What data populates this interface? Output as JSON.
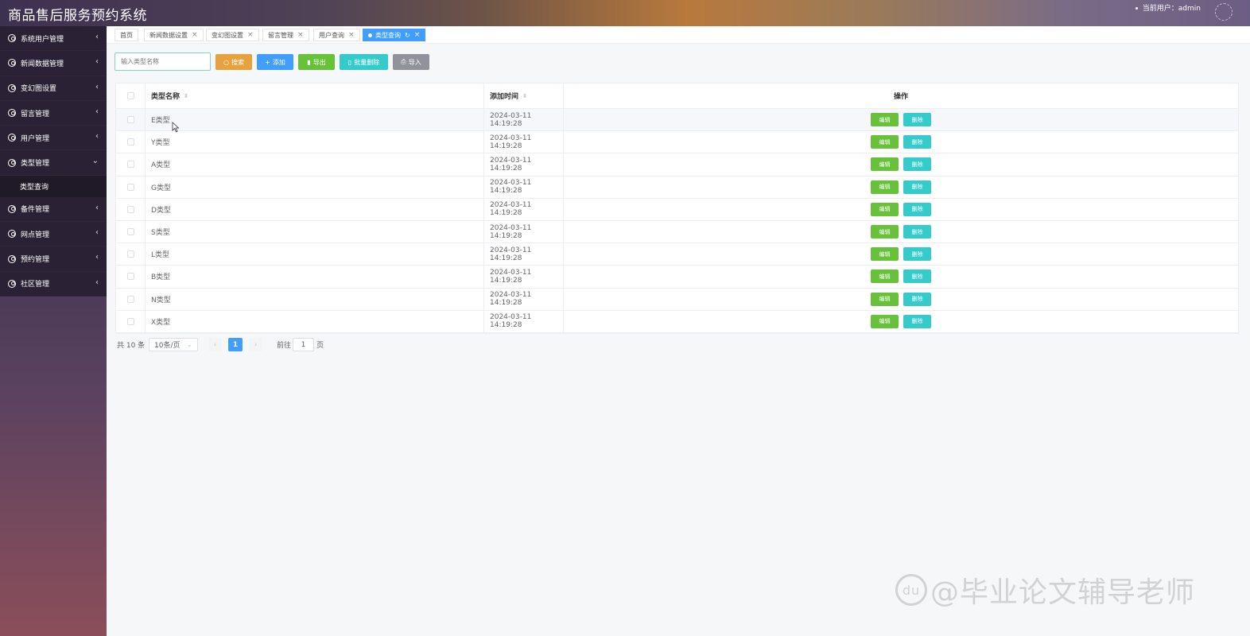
{
  "header": {
    "title": "商品售后服务预约系统",
    "user_label": "当前用户：admin"
  },
  "sidebar": {
    "items": [
      {
        "label": "系统用户管理"
      },
      {
        "label": "新闻数据管理"
      },
      {
        "label": "变幻图设置"
      },
      {
        "label": "留言管理"
      },
      {
        "label": "用户管理"
      },
      {
        "label": "类型管理"
      },
      {
        "label": "备件管理"
      },
      {
        "label": "网点管理"
      },
      {
        "label": "预约管理"
      },
      {
        "label": "社区管理"
      }
    ],
    "submenu_label": "类型查询"
  },
  "tabs": [
    {
      "label": "首页"
    },
    {
      "label": "新闻数据设置"
    },
    {
      "label": "变幻图设置"
    },
    {
      "label": "留言管理"
    },
    {
      "label": "用户查询"
    },
    {
      "label": "类型查询"
    }
  ],
  "toolbar": {
    "search_placeholder": "输入类型名称",
    "search_label": "搜索",
    "add_label": "添加",
    "export_label": "导出",
    "batch_delete_label": "批量删除",
    "import_label": "导入",
    "colors": {
      "search": "#e6a23c",
      "add": "#409eff",
      "export": "#67c23a",
      "batch_delete": "#36cbcb",
      "import": "#909399"
    }
  },
  "table": {
    "headers": {
      "name": "类型名称",
      "time": "添加时间",
      "ops": "操作"
    },
    "edit_label": "编辑",
    "delete_label": "删除",
    "rows": [
      {
        "name": "E类型",
        "time": "2024-03-11 14:19:28"
      },
      {
        "name": "Y类型",
        "time": "2024-03-11 14:19:28"
      },
      {
        "name": "A类型",
        "time": "2024-03-11 14:19:28"
      },
      {
        "name": "G类型",
        "time": "2024-03-11 14:19:28"
      },
      {
        "name": "D类型",
        "time": "2024-03-11 14:19:28"
      },
      {
        "name": "S类型",
        "time": "2024-03-11 14:19:28"
      },
      {
        "name": "L类型",
        "time": "2024-03-11 14:19:28"
      },
      {
        "name": "B类型",
        "time": "2024-03-11 14:19:28"
      },
      {
        "name": "N类型",
        "time": "2024-03-11 14:19:28"
      },
      {
        "name": "X类型",
        "time": "2024-03-11 14:19:28"
      }
    ]
  },
  "pagination": {
    "total_label": "共 10 条",
    "page_size": "10条/页",
    "current_page": "1",
    "goto_label": "前往",
    "goto_value": "1",
    "page_suffix": "页"
  },
  "watermark": {
    "logo": "du",
    "text": "@毕业论文辅导老师"
  }
}
